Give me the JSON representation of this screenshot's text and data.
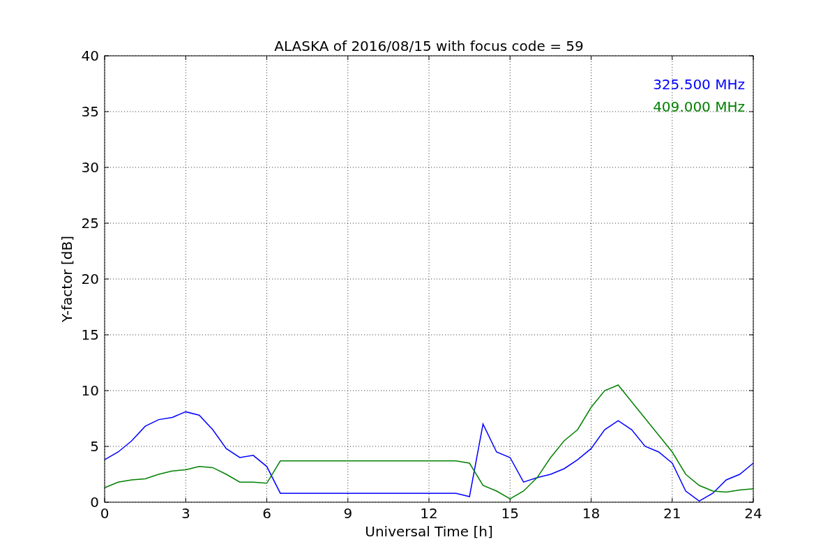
{
  "chart": {
    "chart_data": {
      "type": "line",
      "title": "ALASKA of 2016/08/15 with focus code = 59",
      "xlabel": "Universal Time [h]",
      "ylabel": "Y-factor [dB]",
      "x": [
        0,
        0.5,
        1,
        1.5,
        2,
        2.5,
        3,
        3.5,
        4,
        4.5,
        5,
        5.5,
        6,
        6.5,
        7,
        7.5,
        8,
        8.5,
        9,
        9.5,
        10,
        10.5,
        11,
        11.5,
        12,
        12.5,
        13,
        13.5,
        14,
        14.5,
        15,
        15.5,
        16,
        16.5,
        17,
        17.5,
        18,
        18.5,
        19,
        19.5,
        20,
        20.5,
        21,
        21.5,
        22,
        22.5,
        23,
        23.5,
        24
      ],
      "series": [
        {
          "name": "325.500 MHz",
          "color": "#0000ff",
          "values": [
            3.8,
            4.5,
            5.5,
            6.8,
            7.4,
            7.6,
            8.1,
            7.8,
            6.5,
            4.8,
            4.0,
            4.2,
            3.2,
            0.8,
            0.8,
            0.8,
            0.8,
            0.8,
            0.8,
            0.8,
            0.8,
            0.8,
            0.8,
            0.8,
            0.8,
            0.8,
            0.8,
            0.5,
            7.0,
            4.5,
            4.0,
            1.8,
            2.2,
            2.5,
            3.0,
            3.8,
            4.8,
            6.5,
            7.3,
            6.5,
            5.0,
            4.5,
            3.5,
            1.0,
            0.1,
            0.8,
            2.0,
            2.5,
            3.5
          ]
        },
        {
          "name": "409.000 MHz",
          "color": "#008000",
          "values": [
            1.3,
            1.8,
            2.0,
            2.1,
            2.5,
            2.8,
            2.9,
            3.2,
            3.1,
            2.5,
            1.8,
            1.8,
            1.7,
            3.7,
            3.7,
            3.7,
            3.7,
            3.7,
            3.7,
            3.7,
            3.7,
            3.7,
            3.7,
            3.7,
            3.7,
            3.7,
            3.7,
            3.5,
            1.5,
            1.0,
            0.3,
            1.0,
            2.2,
            4.0,
            5.5,
            6.5,
            8.5,
            10.0,
            10.5,
            9.0,
            7.5,
            6.0,
            4.5,
            2.5,
            1.5,
            1.0,
            0.9,
            1.1,
            1.2
          ]
        }
      ],
      "xlim": [
        0,
        24
      ],
      "ylim": [
        0,
        40
      ],
      "xticks": [
        0,
        3,
        6,
        9,
        12,
        15,
        18,
        21,
        24
      ],
      "yticks": [
        0,
        5,
        10,
        15,
        20,
        25,
        30,
        35,
        40
      ],
      "grid": true
    }
  }
}
